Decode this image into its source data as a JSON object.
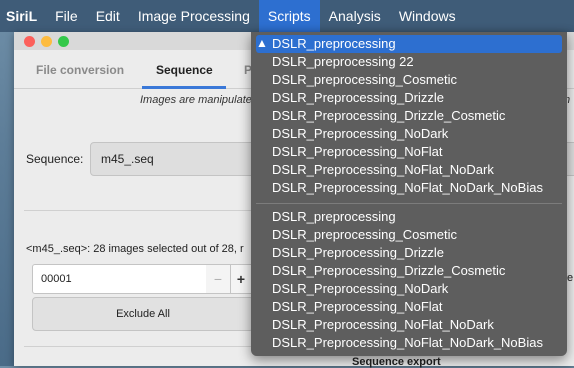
{
  "menubar": {
    "app_name": "SiriL",
    "items": [
      "File",
      "Edit",
      "Image Processing",
      "Scripts",
      "Analysis",
      "Windows"
    ]
  },
  "tabs": {
    "file_conversion": "File conversion",
    "sequence": "Sequence",
    "partial": "P"
  },
  "info_text": "Images are manipulate",
  "info_tail": "n",
  "sequence": {
    "label": "Sequence:",
    "value": "m45_.seq"
  },
  "summary": "<m45_.seq>: 28 images selected out of 28, r",
  "frame": {
    "value": "00001",
    "minus": "−",
    "plus": "+"
  },
  "right_cut": "fe",
  "exclude_all": "Exclude All",
  "sequence_export": "Sequence export",
  "scripts_menu": {
    "group1": [
      "DSLR_preprocessing",
      "DSLR_preprocessing 22",
      "DSLR_preprocessing_Cosmetic",
      "DSLR_Preprocessing_Drizzle",
      "DSLR_Preprocessing_Drizzle_Cosmetic",
      "DSLR_Preprocessing_NoDark",
      "DSLR_Preprocessing_NoFlat",
      "DSLR_Preprocessing_NoFlat_NoDark",
      "DSLR_Preprocessing_NoFlat_NoDark_NoBias"
    ],
    "group2": [
      "DSLR_preprocessing",
      "DSLR_preprocessing_Cosmetic",
      "DSLR_Preprocessing_Drizzle",
      "DSLR_Preprocessing_Drizzle_Cosmetic",
      "DSLR_Preprocessing_NoDark",
      "DSLR_Preprocessing_NoFlat",
      "DSLR_Preprocessing_NoFlat_NoDark",
      "DSLR_Preprocessing_NoFlat_NoDark_NoBias"
    ]
  },
  "colors": {
    "menu_highlight": "#2d6fd0",
    "menu_background": "#5e5e5e",
    "tab_accent": "#3a78d8"
  }
}
